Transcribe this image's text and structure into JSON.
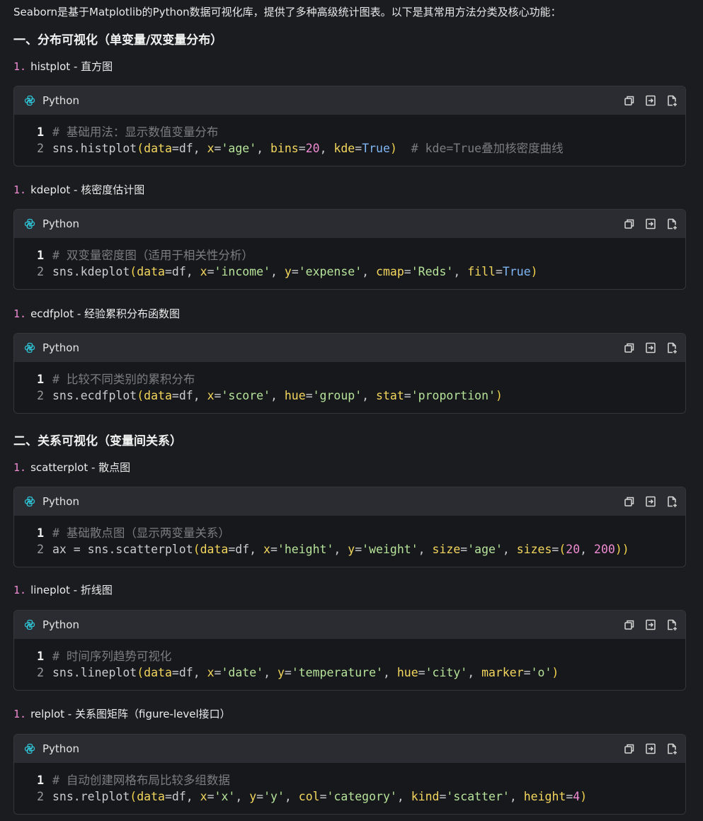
{
  "intro": "Seaborn是基于Matplotlib的Python数据可视化库，提供了多种高级统计图表。以下是其常用方法分类及核心功能：",
  "colors": {
    "background": "#1b1c1f",
    "code_bg": "#17181b",
    "header_bg": "#2b2c31",
    "accent_icon": "#2ec4d6",
    "comment": "#7a7d82",
    "string": "#b6e39a",
    "number": "#ee8bd2",
    "keyword": "#f4d75e",
    "bool": "#7fb6f5"
  },
  "sections": [
    {
      "heading": "一、分布可视化（单变量/双变量分布）",
      "items": [
        {
          "num": "1.",
          "title": "histplot - 直方图",
          "language": "Python",
          "actions": [
            "copy-icon",
            "insert-icon",
            "new-file-icon"
          ],
          "code": [
            {
              "n": "1",
              "tokens": [
                {
                  "t": "# 基础用法：显示数值变量分布",
                  "c": "comment"
                }
              ]
            },
            {
              "n": "2",
              "tokens": [
                {
                  "t": "sns.histplot",
                  "c": "plain"
                },
                {
                  "t": "(",
                  "c": "paren"
                },
                {
                  "t": "data",
                  "c": "kw"
                },
                {
                  "t": "=df, ",
                  "c": "plain"
                },
                {
                  "t": "x",
                  "c": "kw"
                },
                {
                  "t": "=",
                  "c": "plain"
                },
                {
                  "t": "'age'",
                  "c": "str"
                },
                {
                  "t": ", ",
                  "c": "plain"
                },
                {
                  "t": "bins",
                  "c": "kw"
                },
                {
                  "t": "=",
                  "c": "plain"
                },
                {
                  "t": "20",
                  "c": "num"
                },
                {
                  "t": ", ",
                  "c": "plain"
                },
                {
                  "t": "kde",
                  "c": "kw"
                },
                {
                  "t": "=",
                  "c": "plain"
                },
                {
                  "t": "True",
                  "c": "bool"
                },
                {
                  "t": ")",
                  "c": "paren"
                },
                {
                  "t": "  ",
                  "c": "plain"
                },
                {
                  "t": "# kde=True叠加核密度曲线",
                  "c": "comment"
                }
              ]
            }
          ]
        },
        {
          "num": "1.",
          "title": "kdeplot - 核密度估计图",
          "language": "Python",
          "actions": [
            "copy-icon",
            "insert-icon",
            "new-file-icon"
          ],
          "code": [
            {
              "n": "1",
              "tokens": [
                {
                  "t": "# 双变量密度图（适用于相关性分析）",
                  "c": "comment"
                }
              ]
            },
            {
              "n": "2",
              "tokens": [
                {
                  "t": "sns.kdeplot",
                  "c": "plain"
                },
                {
                  "t": "(",
                  "c": "paren"
                },
                {
                  "t": "data",
                  "c": "kw"
                },
                {
                  "t": "=df, ",
                  "c": "plain"
                },
                {
                  "t": "x",
                  "c": "kw"
                },
                {
                  "t": "=",
                  "c": "plain"
                },
                {
                  "t": "'income'",
                  "c": "str"
                },
                {
                  "t": ", ",
                  "c": "plain"
                },
                {
                  "t": "y",
                  "c": "kw"
                },
                {
                  "t": "=",
                  "c": "plain"
                },
                {
                  "t": "'expense'",
                  "c": "str"
                },
                {
                  "t": ", ",
                  "c": "plain"
                },
                {
                  "t": "cmap",
                  "c": "kw"
                },
                {
                  "t": "=",
                  "c": "plain"
                },
                {
                  "t": "'Reds'",
                  "c": "str"
                },
                {
                  "t": ", ",
                  "c": "plain"
                },
                {
                  "t": "fill",
                  "c": "kw"
                },
                {
                  "t": "=",
                  "c": "plain"
                },
                {
                  "t": "True",
                  "c": "bool"
                },
                {
                  "t": ")",
                  "c": "paren"
                }
              ]
            }
          ]
        },
        {
          "num": "1.",
          "title": "ecdfplot - 经验累积分布函数图",
          "language": "Python",
          "actions": [
            "copy-icon",
            "insert-icon",
            "new-file-icon"
          ],
          "code": [
            {
              "n": "1",
              "tokens": [
                {
                  "t": "# 比较不同类别的累积分布",
                  "c": "comment"
                }
              ]
            },
            {
              "n": "2",
              "tokens": [
                {
                  "t": "sns.ecdfplot",
                  "c": "plain"
                },
                {
                  "t": "(",
                  "c": "paren"
                },
                {
                  "t": "data",
                  "c": "kw"
                },
                {
                  "t": "=df, ",
                  "c": "plain"
                },
                {
                  "t": "x",
                  "c": "kw"
                },
                {
                  "t": "=",
                  "c": "plain"
                },
                {
                  "t": "'score'",
                  "c": "str"
                },
                {
                  "t": ", ",
                  "c": "plain"
                },
                {
                  "t": "hue",
                  "c": "kw"
                },
                {
                  "t": "=",
                  "c": "plain"
                },
                {
                  "t": "'group'",
                  "c": "str"
                },
                {
                  "t": ", ",
                  "c": "plain"
                },
                {
                  "t": "stat",
                  "c": "kw"
                },
                {
                  "t": "=",
                  "c": "plain"
                },
                {
                  "t": "'proportion'",
                  "c": "str"
                },
                {
                  "t": ")",
                  "c": "paren"
                }
              ]
            }
          ]
        }
      ]
    },
    {
      "heading": "二、关系可视化（变量间关系）",
      "items": [
        {
          "num": "1.",
          "title": "scatterplot - 散点图",
          "language": "Python",
          "actions": [
            "copy-icon",
            "insert-icon",
            "new-file-icon"
          ],
          "code": [
            {
              "n": "1",
              "tokens": [
                {
                  "t": "# 基础散点图（显示两变量关系）",
                  "c": "comment"
                }
              ]
            },
            {
              "n": "2",
              "tokens": [
                {
                  "t": "ax = sns.scatterplot",
                  "c": "plain"
                },
                {
                  "t": "(",
                  "c": "paren"
                },
                {
                  "t": "data",
                  "c": "kw"
                },
                {
                  "t": "=df, ",
                  "c": "plain"
                },
                {
                  "t": "x",
                  "c": "kw"
                },
                {
                  "t": "=",
                  "c": "plain"
                },
                {
                  "t": "'height'",
                  "c": "str"
                },
                {
                  "t": ", ",
                  "c": "plain"
                },
                {
                  "t": "y",
                  "c": "kw"
                },
                {
                  "t": "=",
                  "c": "plain"
                },
                {
                  "t": "'weight'",
                  "c": "str"
                },
                {
                  "t": ", ",
                  "c": "plain"
                },
                {
                  "t": "size",
                  "c": "kw"
                },
                {
                  "t": "=",
                  "c": "plain"
                },
                {
                  "t": "'age'",
                  "c": "str"
                },
                {
                  "t": ", ",
                  "c": "plain"
                },
                {
                  "t": "sizes",
                  "c": "kw"
                },
                {
                  "t": "=",
                  "c": "plain"
                },
                {
                  "t": "(",
                  "c": "paren"
                },
                {
                  "t": "20",
                  "c": "num"
                },
                {
                  "t": ", ",
                  "c": "plain"
                },
                {
                  "t": "200",
                  "c": "num"
                },
                {
                  "t": "))",
                  "c": "paren"
                }
              ]
            }
          ]
        },
        {
          "num": "1.",
          "title": "lineplot - 折线图",
          "language": "Python",
          "actions": [
            "copy-icon",
            "insert-icon",
            "new-file-icon"
          ],
          "code": [
            {
              "n": "1",
              "tokens": [
                {
                  "t": "# 时间序列趋势可视化",
                  "c": "comment"
                }
              ]
            },
            {
              "n": "2",
              "tokens": [
                {
                  "t": "sns.lineplot",
                  "c": "plain"
                },
                {
                  "t": "(",
                  "c": "paren"
                },
                {
                  "t": "data",
                  "c": "kw"
                },
                {
                  "t": "=df, ",
                  "c": "plain"
                },
                {
                  "t": "x",
                  "c": "kw"
                },
                {
                  "t": "=",
                  "c": "plain"
                },
                {
                  "t": "'date'",
                  "c": "str"
                },
                {
                  "t": ", ",
                  "c": "plain"
                },
                {
                  "t": "y",
                  "c": "kw"
                },
                {
                  "t": "=",
                  "c": "plain"
                },
                {
                  "t": "'temperature'",
                  "c": "str"
                },
                {
                  "t": ", ",
                  "c": "plain"
                },
                {
                  "t": "hue",
                  "c": "kw"
                },
                {
                  "t": "=",
                  "c": "plain"
                },
                {
                  "t": "'city'",
                  "c": "str"
                },
                {
                  "t": ", ",
                  "c": "plain"
                },
                {
                  "t": "marker",
                  "c": "kw"
                },
                {
                  "t": "=",
                  "c": "plain"
                },
                {
                  "t": "'o'",
                  "c": "str"
                },
                {
                  "t": ")",
                  "c": "paren"
                }
              ]
            }
          ]
        },
        {
          "num": "1.",
          "title": "relplot - 关系图矩阵（figure-level接口）",
          "language": "Python",
          "actions": [
            "copy-icon",
            "insert-icon",
            "new-file-icon"
          ],
          "code": [
            {
              "n": "1",
              "tokens": [
                {
                  "t": "# 自动创建网格布局比较多组数据",
                  "c": "comment"
                }
              ]
            },
            {
              "n": "2",
              "tokens": [
                {
                  "t": "sns.relplot",
                  "c": "plain"
                },
                {
                  "t": "(",
                  "c": "paren"
                },
                {
                  "t": "data",
                  "c": "kw"
                },
                {
                  "t": "=df, ",
                  "c": "plain"
                },
                {
                  "t": "x",
                  "c": "kw"
                },
                {
                  "t": "=",
                  "c": "plain"
                },
                {
                  "t": "'x'",
                  "c": "str"
                },
                {
                  "t": ", ",
                  "c": "plain"
                },
                {
                  "t": "y",
                  "c": "kw"
                },
                {
                  "t": "=",
                  "c": "plain"
                },
                {
                  "t": "'y'",
                  "c": "str"
                },
                {
                  "t": ", ",
                  "c": "plain"
                },
                {
                  "t": "col",
                  "c": "kw"
                },
                {
                  "t": "=",
                  "c": "plain"
                },
                {
                  "t": "'category'",
                  "c": "str"
                },
                {
                  "t": ", ",
                  "c": "plain"
                },
                {
                  "t": "kind",
                  "c": "kw"
                },
                {
                  "t": "=",
                  "c": "plain"
                },
                {
                  "t": "'scatter'",
                  "c": "str"
                },
                {
                  "t": ", ",
                  "c": "plain"
                },
                {
                  "t": "height",
                  "c": "kw"
                },
                {
                  "t": "=",
                  "c": "plain"
                },
                {
                  "t": "4",
                  "c": "num"
                },
                {
                  "t": ")",
                  "c": "paren"
                }
              ]
            }
          ]
        }
      ]
    }
  ]
}
